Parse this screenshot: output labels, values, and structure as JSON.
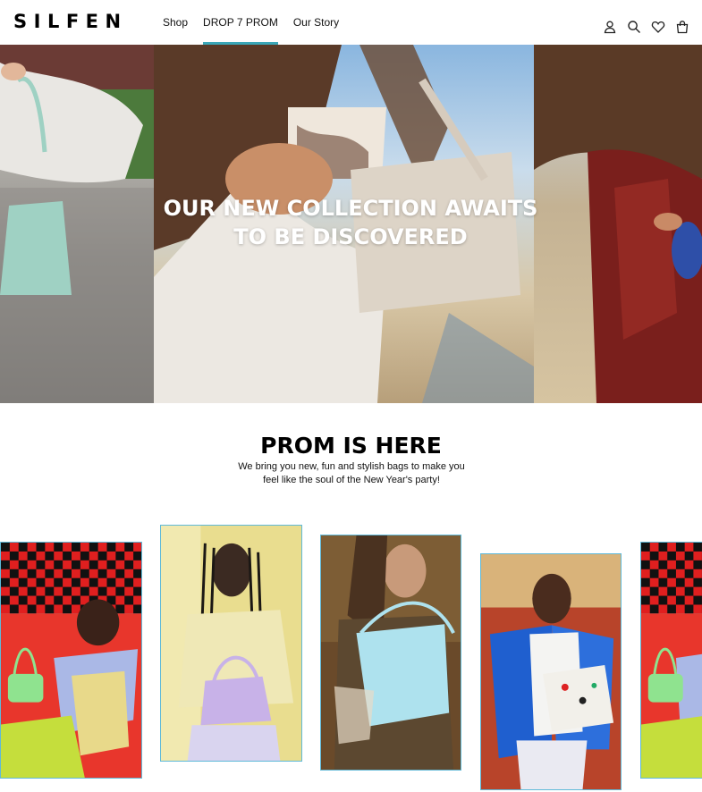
{
  "header": {
    "logo": "SILFEN",
    "nav": [
      "Shop",
      "DROP 7 PROM",
      "Our Story"
    ],
    "active_nav": "DROP 7 PROM",
    "icons": [
      "user-icon",
      "search-icon",
      "heart-icon",
      "bag-icon"
    ],
    "accent_color": "#3aa7b8"
  },
  "hero": {
    "title_line1": "OUR NEW COLLECTION AWAITS",
    "title_line2": "TO BE DISCOVERED"
  },
  "prom": {
    "title": "PROM IS HERE",
    "text_line1": "We bring you new, fun and stylish bags to make you",
    "text_line2": "feel like the soul of the New Year's party!"
  },
  "gallery": {
    "border_color": "#5fb9d8",
    "cards": [
      {
        "name": "green-bag-photo",
        "bag_color": "#8fe38f"
      },
      {
        "name": "lilac-bag-photo",
        "bag_color": "#c8b2e8"
      },
      {
        "name": "blue-bag-photo",
        "bag_color": "#aee2ee"
      },
      {
        "name": "print-bag-photo",
        "bag_color": "#f2f0ea"
      },
      {
        "name": "green-bag-photo-repeat",
        "bag_color": "#8fe38f"
      }
    ]
  }
}
